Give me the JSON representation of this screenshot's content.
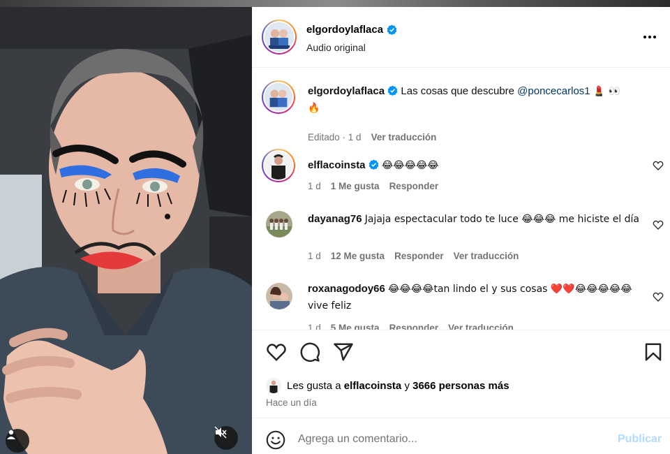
{
  "post": {
    "username": "elgordoylaflaca",
    "audio": "Audio original"
  },
  "caption": {
    "username": "elgordoylaflaca",
    "text": "Las cosas que descubre",
    "mention": "@poncecarlos1",
    "emojis": "💄 👀",
    "emoji2": "🔥",
    "edited": "Editado · 1 d",
    "translate": "Ver traducción"
  },
  "comments": [
    {
      "username": "elflacoinsta",
      "verified": true,
      "text": "😂😂😂😂😂",
      "time": "1 d",
      "likes": "1 Me gusta",
      "reply": "Responder",
      "translate": ""
    },
    {
      "username": "dayanag76",
      "verified": false,
      "text": "Jajaja espectacular todo te luce 😂😂😂 me hiciste el día",
      "time": "1 d",
      "likes": "12 Me gusta",
      "reply": "Responder",
      "translate": "Ver traducción"
    },
    {
      "username": "roxanagodoy66",
      "verified": false,
      "text": "😂😂😂😂tan lindo el y sus cosas ❤️❤️😂😂😂😂😂vive feliz",
      "time": "1 d",
      "likes": "5 Me gusta",
      "reply": "Responder",
      "translate": "Ver traducción"
    }
  ],
  "likes": {
    "prefix": "Les gusta a",
    "user": "elflacoinsta",
    "connector": "y",
    "others": "3666 personas más"
  },
  "time_ago": "Hace un día",
  "composer": {
    "placeholder": "Agrega un comentario...",
    "publish": "Publicar"
  },
  "icons": [
    "heart-icon",
    "comment-icon",
    "share-icon",
    "bookmark-icon",
    "emoji-icon",
    "more-icon",
    "mute-icon",
    "user-tag-icon",
    "verified-icon"
  ],
  "colors": {
    "verified_blue": "#0095f6",
    "publish_disabled": "#b3dbff",
    "meta_gray": "#737373",
    "mention": "#00376b"
  }
}
